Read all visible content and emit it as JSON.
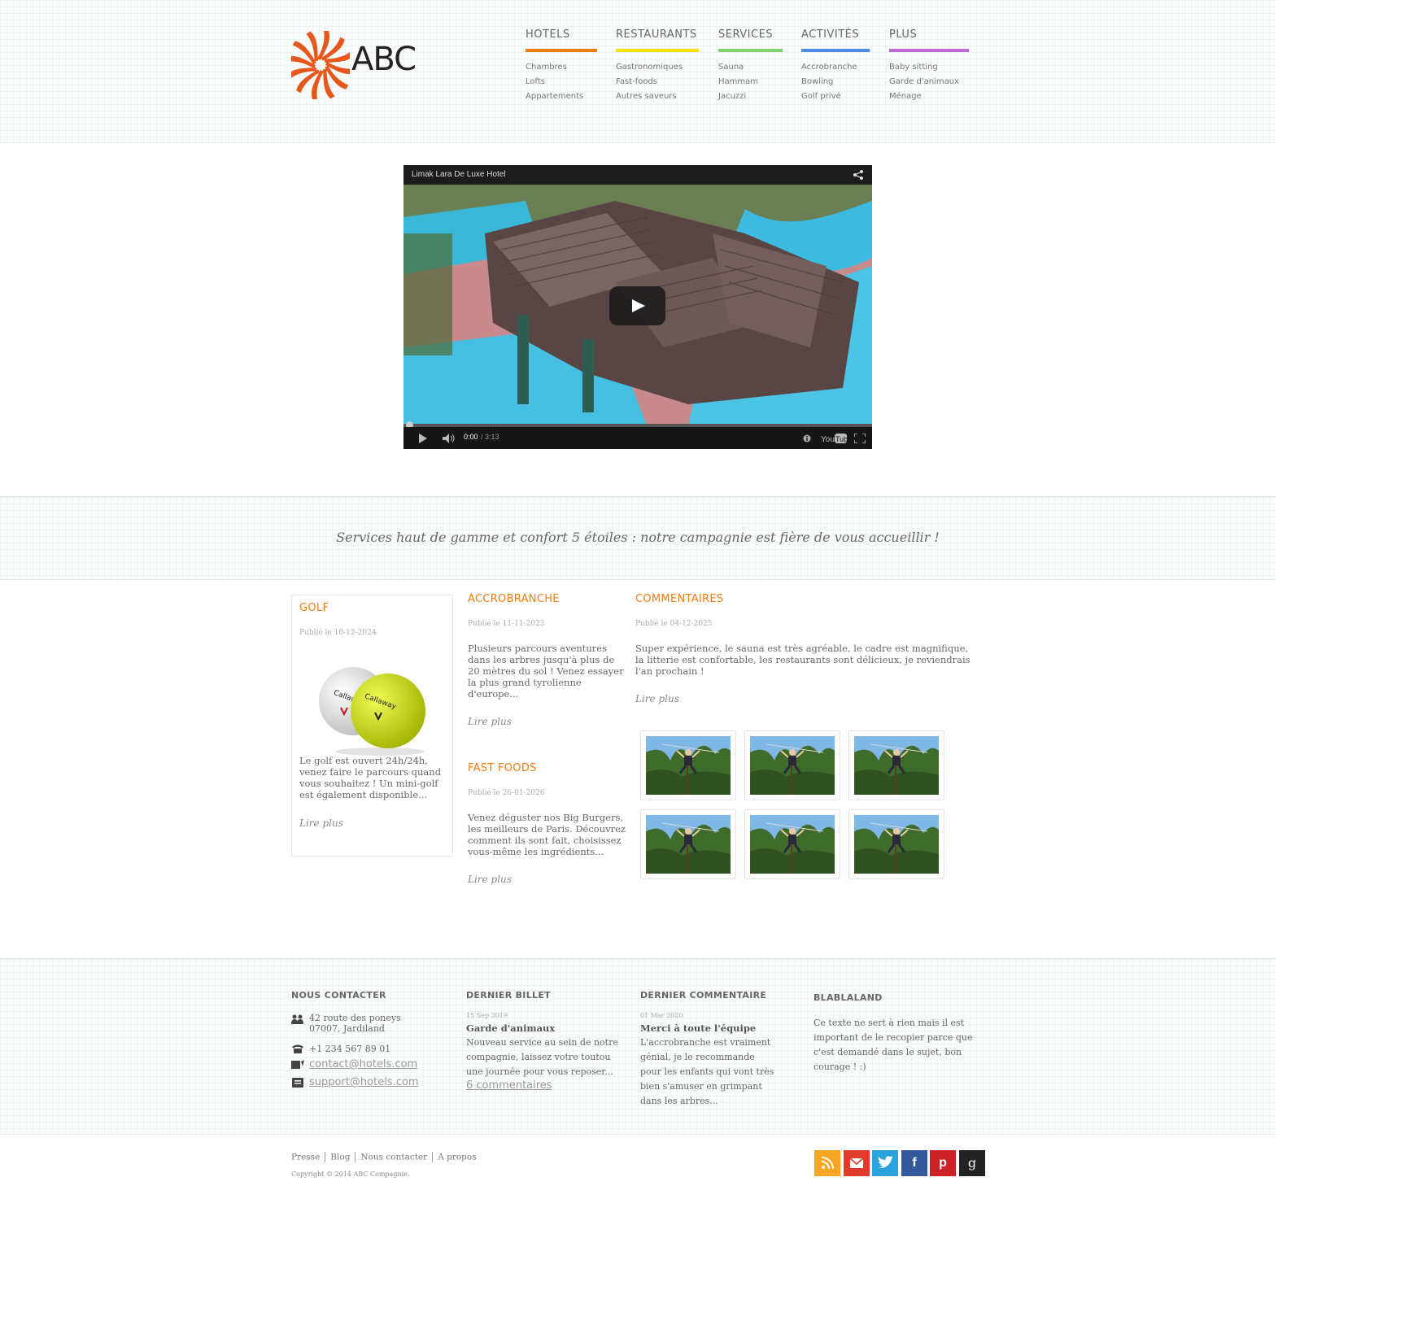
{
  "brand": {
    "name": "ABC",
    "logo_color": "#e5571b"
  },
  "nav": [
    {
      "title": "HOTELS",
      "color": "#f07d10",
      "items": [
        "Chambres",
        "Lofts",
        "Appartements"
      ]
    },
    {
      "title": "RESTAURANTS",
      "color": "#f2e40e",
      "items": [
        "Gastronomiques",
        "Fast-foods",
        "Autres saveurs"
      ]
    },
    {
      "title": "SERVICES",
      "color": "#7dd36b",
      "items": [
        "Sauna",
        "Hammam",
        "Jacuzzi"
      ]
    },
    {
      "title": "ACTIVITÉS",
      "color": "#4b8de6",
      "items": [
        "Accrobranche",
        "Bowling",
        "Golf privé"
      ]
    },
    {
      "title": "PLUS",
      "color": "#c068d8",
      "items": [
        "Baby sitting",
        "Garde d'animaux",
        "Ménage"
      ]
    }
  ],
  "video": {
    "title": "Limak Lara De Luxe Hotel",
    "time_current": "0:00",
    "time_total": "/ 3:13",
    "progress_fraction": 0,
    "provider_icon": "youtube-icon"
  },
  "tagline": "Services haut de gamme et confort 5 étoiles : notre campagnie est fière de vous accueillir !",
  "posts": {
    "golf": {
      "title": "GOLF",
      "date": "Publié le 10-12-2024",
      "text": "Le golf est ouvert 24h/24h, venez faire le parcours quand vous souhaitez ! Un mini-golf est également disponible...",
      "read_more": "Lire plus"
    },
    "accrobranche": {
      "title": "ACCROBRANCHE",
      "date": "Publié le 11-11-2023",
      "text": "Plusieurs parcours aventures dans les arbres jusqu'à plus de 20 mètres du sol ! Venez essayer la plus grand tyrolienne d'europe...",
      "read_more": "Lire plus"
    },
    "fastfoods": {
      "title": "FAST FOODS",
      "date": "Publié le 26-01-2026",
      "text": "Venez déguster nos Big Burgers, les meilleurs de Paris. Découvrez comment ils sont fait, choisissez vous-même les ingrédients...",
      "read_more": "Lire plus"
    },
    "commentaires": {
      "title": "COMMENTAIRES",
      "date": "Publié le 04-12-2025",
      "text": "Super expérience, le sauna est très agréable, le cadre est magnifique, la litterie est confortable, les restaurants sont délicieux, je reviendrais l'an prochain !",
      "read_more": "Lire plus"
    }
  },
  "footer": {
    "contact": {
      "heading": "NOUS CONTACTER",
      "address_line1": "42 route des poneys",
      "address_line2": "07007, Jardiland",
      "phone": "+1 234 567 89 01",
      "email1": "contact@hotels.com",
      "email2": "support@hotels.com"
    },
    "billet": {
      "heading": "DERNIER BILLET",
      "date": "15 Sep 2019",
      "title": "Garde d'animaux",
      "text": "Nouveau service au sein de notre compagnie, laissez votre toutou une journée pour vous reposer...",
      "link": "6 commentaires"
    },
    "commentaire": {
      "heading": "DERNIER COMMENTAIRE",
      "date": "01 Mar 2020",
      "title": "Merci à toute l'équipe",
      "text": "L'accrobranche est vraiment génial, je le recommande pour les enfants qui vont très bien s'amuser en grimpant dans les arbres..."
    },
    "blabla": {
      "heading": "BLABLALAND",
      "text": "Ce texte ne sert à rien mais il est important de le recopier parce que c'est demandé dans le sujet, bon courage ! :)"
    }
  },
  "bottom": {
    "links": [
      "Presse",
      "Blog",
      "Nous contacter",
      "A propos"
    ],
    "copyright": "Copyright © 2014 ABC Compagnie.",
    "social": [
      {
        "name": "rss-icon",
        "color": "#f5a623",
        "glyph": ""
      },
      {
        "name": "mail-icon",
        "color": "#e03c2b",
        "glyph": ""
      },
      {
        "name": "twitter-icon",
        "color": "#2aa3dc",
        "glyph": ""
      },
      {
        "name": "facebook-icon",
        "color": "#34589c",
        "glyph": "f"
      },
      {
        "name": "pinterest-icon",
        "color": "#cc2127",
        "glyph": "p"
      },
      {
        "name": "google-icon",
        "color": "#222222",
        "glyph": "g"
      }
    ]
  }
}
